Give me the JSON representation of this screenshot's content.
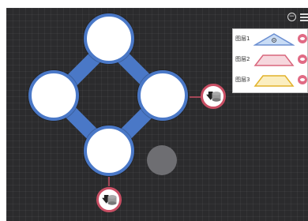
{
  "canvas": {
    "background": "#2b2b2d",
    "ring_color": "#4a78c7",
    "node_border": "#4a78c7",
    "port_border": "#c94f64"
  },
  "toolbar": {
    "collapse_icon": "minus-circle-icon",
    "menu_icon": "menu-icon"
  },
  "layers": [
    {
      "label": "图层1",
      "shape": "triangle",
      "fill": "#c9dcf5",
      "stroke": "#6b8fd1",
      "selected": true
    },
    {
      "label": "图层2",
      "shape": "trapezoid",
      "fill": "#f6d7dd",
      "stroke": "#d9667d",
      "selected": false
    },
    {
      "label": "图层3",
      "shape": "trapezoid",
      "fill": "#fbeec0",
      "stroke": "#e2b22a",
      "selected": false
    }
  ],
  "ports": [
    {
      "icon": "download-disk-icon",
      "arrow": "🡇"
    },
    {
      "icon": "download-disk-icon",
      "arrow": "🡇"
    }
  ]
}
